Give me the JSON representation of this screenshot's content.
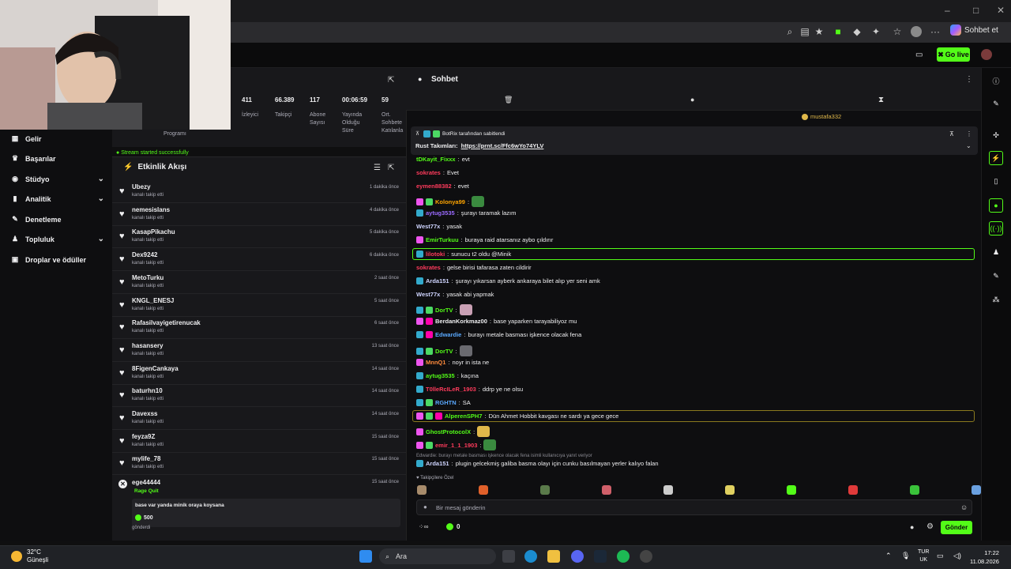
{
  "browser": {
    "sohbet_et": "Sohbet et",
    "window_controls": [
      "–",
      "□",
      "✕"
    ]
  },
  "kick": {
    "go_live": "Go live",
    "accent": "#53fc18"
  },
  "sidebar": {
    "items": [
      {
        "label": "Gelir",
        "icon": "chart-icon"
      },
      {
        "label": "Başarılar",
        "icon": "trophy-icon"
      },
      {
        "label": "Stüdyo",
        "icon": "studio-icon",
        "expandable": true
      },
      {
        "label": "Analitik",
        "icon": "analytics-icon",
        "expandable": true
      },
      {
        "label": "Denetleme",
        "icon": "wrench-icon"
      },
      {
        "label": "Topluluk",
        "icon": "community-icon",
        "expandable": true
      },
      {
        "label": "Droplar ve ödüller",
        "icon": "gift-icon"
      }
    ]
  },
  "stats": {
    "program_label": "Programı",
    "stream_started": "Stream started successfully",
    "items": [
      {
        "value": "411",
        "label": "İzleyici"
      },
      {
        "value": "66.389",
        "label": "Takipçi"
      },
      {
        "value": "117",
        "label": "Abone Sayısı"
      },
      {
        "value": "00:06:59",
        "label": "Yayında Olduğu Süre"
      },
      {
        "value": "59",
        "label": "Ort. Sohbete Katılanla"
      }
    ]
  },
  "activity": {
    "title": "Etkinlik Akışı",
    "rows": [
      {
        "name": "Ubezy",
        "action": "kanalı takip etti",
        "time": "1 dakika önce"
      },
      {
        "name": "nemesislans",
        "action": "kanalı takip etti",
        "time": "4 dakika önce"
      },
      {
        "name": "KasapPikachu",
        "action": "kanalı takip etti",
        "time": "5 dakika önce"
      },
      {
        "name": "Dex9242",
        "action": "kanalı takip etti",
        "time": "6 dakika önce"
      },
      {
        "name": "MetoTurku",
        "action": "kanalı takip etti",
        "time": "2 saat önce"
      },
      {
        "name": "KNGL_ENESJ",
        "action": "kanalı takip etti",
        "time": "5 saat önce"
      },
      {
        "name": "Rafasilvayigetirenucak",
        "action": "kanalı takip etti",
        "time": "6 saat önce"
      },
      {
        "name": "hasansery",
        "action": "kanalı takip etti",
        "time": "13 saat önce"
      },
      {
        "name": "8FigenCankaya",
        "action": "kanalı takip etti",
        "time": "14 saat önce"
      },
      {
        "name": "baturhn10",
        "action": "kanalı takip etti",
        "time": "14 saat önce"
      },
      {
        "name": "Davexss",
        "action": "kanalı takip etti",
        "time": "14 saat önce"
      },
      {
        "name": "feyza9Z",
        "action": "kanalı takip etti",
        "time": "15 saat önce"
      },
      {
        "name": "mylife_78",
        "action": "kanalı takip etti",
        "time": "15 saat önce"
      }
    ],
    "rage": {
      "name": "ege44444",
      "tag": "Rage Quit",
      "time": "15 saat önce",
      "message": "base var yanda minik oraya koysana",
      "amount": "500",
      "sent": "gönderdi"
    }
  },
  "chat": {
    "title": "Sohbet",
    "top_user": "mustafa332",
    "pinned_by": "BotRix tarafından sabitlendi",
    "pinned_text_prefix": "Rust Takımları:",
    "pinned_link": "https://prnt.sc/Ffc6wYo74YLV",
    "messages": [
      {
        "user": "tDKayit_Fixxx",
        "color": "#53fc18",
        "text": "evt",
        "badges": []
      },
      {
        "user": "sokrates",
        "color": "#ff3b5c",
        "text": "Evet",
        "badges": []
      },
      {
        "user": "eymen88382",
        "color": "#ff3b5c",
        "text": "evet",
        "badges": []
      },
      {
        "user": "Kolonya99",
        "color": "#ffa500",
        "text": "",
        "badges": [
          "sub",
          "og"
        ],
        "emote": "#3a8a3f"
      },
      {
        "user": "aytug3535",
        "color": "#9b6bff",
        "text": "şurayı taramak lazım",
        "badges": [
          "mod"
        ]
      },
      {
        "user": "West77x",
        "color": "#cfd5ff",
        "text": "yasak",
        "badges": []
      },
      {
        "user": "EmirTurkuu",
        "color": "#53fc18",
        "text": "buraya raid atarsanız aybo çıldırır",
        "badges": [
          "sub"
        ]
      },
      {
        "user": "lilotoki",
        "color": "#ff3b5c",
        "text": "sunucu t2 oldu @Minik",
        "badges": [
          "mod"
        ],
        "highlight": "green"
      },
      {
        "user": "sokrates",
        "color": "#ff3b5c",
        "text": "gelse birisi tafarasa zaten cildirir",
        "badges": []
      },
      {
        "user": "Arda151",
        "color": "#cfd5ff",
        "text": "şurayı yıkarsan ayberk ankaraya bilet alıp yer seni amk",
        "badges": [
          "mod"
        ]
      },
      {
        "user": "West77x",
        "color": "#cfd5ff",
        "text": "yasak abi yapmak",
        "badges": []
      },
      {
        "user": "DorTV",
        "color": "#53fc18",
        "text": "",
        "badges": [
          "mod",
          "og"
        ],
        "emote": "#c9a0b4"
      },
      {
        "user": "BerdanKorkmaz00",
        "color": "#efeff1",
        "text": "base yaparken tarayabiliyoz mu",
        "badges": [
          "sub",
          "vip"
        ]
      },
      {
        "user": "Edwardie",
        "color": "#5aa9ff",
        "text": "burayı metale basması işkence olacak fena",
        "badges": [
          "mod",
          "vip"
        ]
      },
      {
        "user": "DorTV",
        "color": "#53fc18",
        "text": "",
        "badges": [
          "mod",
          "og"
        ],
        "emote": "#6a6a70"
      },
      {
        "user": "MnnQ1",
        "color": "#ff8a3c",
        "text": "noyr in ista ne",
        "badges": [
          "sub"
        ]
      },
      {
        "user": "aytug3535",
        "color": "#53fc18",
        "text": "kaçına",
        "badges": [
          "mod"
        ]
      },
      {
        "user": "T0lleRcILeR_1903",
        "color": "#ff3b5c",
        "text": "ddrp ye ne olsu",
        "badges": [
          "mod"
        ]
      },
      {
        "user": "RGHTN",
        "color": "#5aa9ff",
        "text": "SA",
        "badges": [
          "mod",
          "og"
        ]
      },
      {
        "user": "AlperenSPH7",
        "color": "#53fc18",
        "text": "Dün Ahmet Hobbit kavgası ne sardı ya gece gece",
        "badges": [
          "sub",
          "og",
          "vip"
        ],
        "highlight": "yellow"
      },
      {
        "user": "GhostProtocolX",
        "color": "#53fc18",
        "text": "",
        "badges": [
          "sub"
        ],
        "emote": "#e0b84a"
      },
      {
        "user": "emir_1_1_1903",
        "color": "#ff3b5c",
        "text": "",
        "badges": [
          "sub",
          "og"
        ],
        "emote": "#3a8a3f"
      }
    ],
    "reply_context": "Edwardie: burayı metale basması işkence olacak fena isimli kullanıcıya yanıt veriyor",
    "last_message": {
      "user": "Arda151",
      "color": "#cfd5ff",
      "text": "plugin gelcekmiş galiba basma olayı için cunku basılmayan yerler kalıyo falan"
    },
    "followers_only": "Takipçilere Özel",
    "input_placeholder": "Bir mesaj gönderin",
    "points": "0",
    "send_label": "Gönder"
  },
  "taskbar": {
    "temp": "32°C",
    "weather": "Güneşli",
    "search": "Ara",
    "lang_top": "TUR",
    "lang_bottom": "UK",
    "time": "17:22",
    "date": "11.08.2026"
  }
}
